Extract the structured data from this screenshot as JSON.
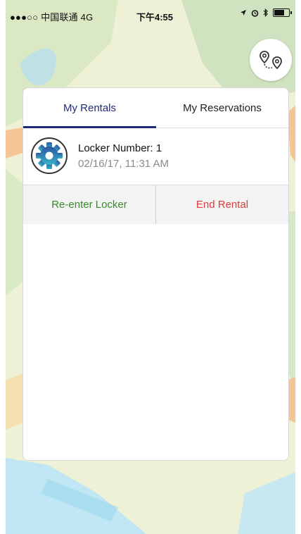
{
  "status_bar": {
    "carrier": "●●●○○ 中国联通  4G",
    "time": "下午4:55",
    "icons": [
      "location-arrow-icon",
      "alarm-icon",
      "bluetooth-icon",
      "battery-icon"
    ]
  },
  "map": {
    "route_button_icon": "route-pins-icon"
  },
  "tabs": {
    "items": [
      {
        "label": "My Rentals",
        "active": true
      },
      {
        "label": "My Reservations",
        "active": false
      }
    ],
    "active_color": "#1f2a7a"
  },
  "rentals": [
    {
      "icon": "gear-icon",
      "title": "Locker Number: 1",
      "time": "02/16/17, 11:31 AM"
    }
  ],
  "actions": {
    "reenter_label": "Re-enter Locker",
    "reenter_color": "#3a8a2a",
    "end_label": "End Rental",
    "end_color": "#e23a3a"
  }
}
